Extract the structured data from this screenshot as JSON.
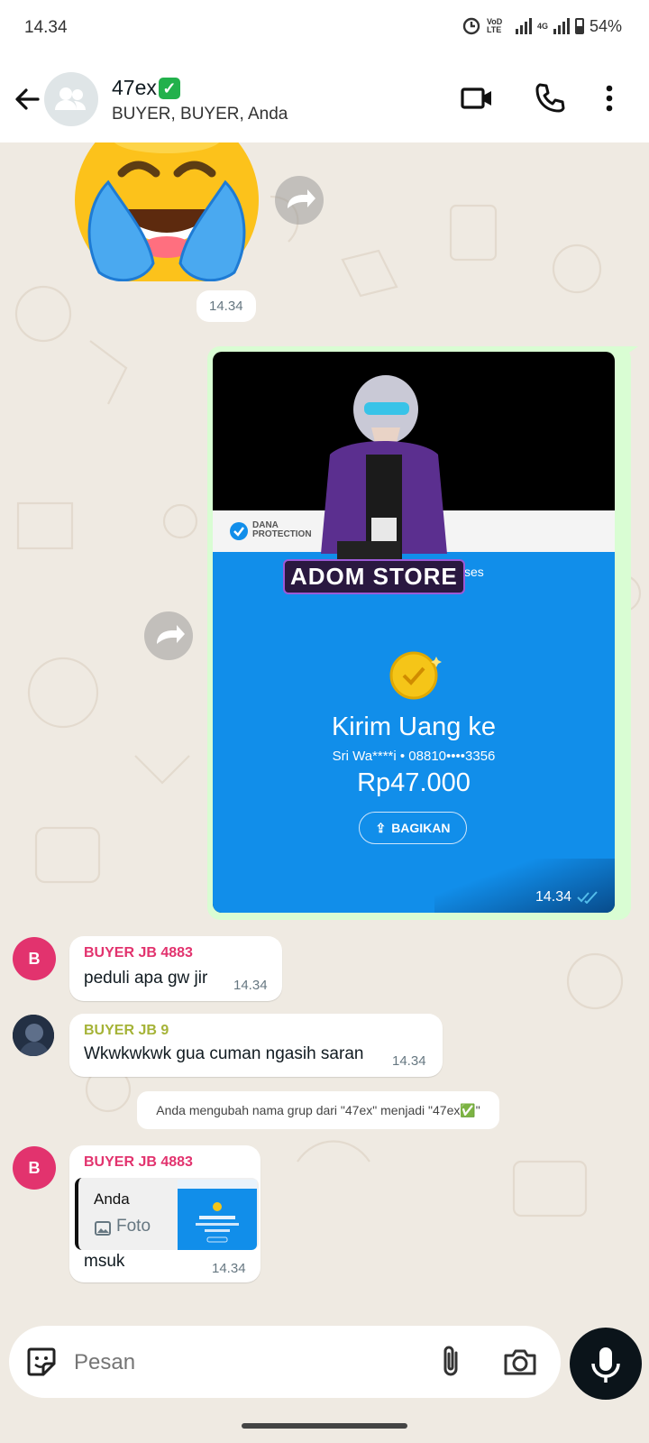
{
  "status_bar": {
    "time": "14.34",
    "network_volte_label": "VoD LTE",
    "network_4g_label": "4G",
    "battery": "54%"
  },
  "header": {
    "group_name": "47ex",
    "members": "BUYER, BUYER, Anda",
    "icons": [
      "back-arrow-icon",
      "group-avatar-icon",
      "video-call-icon",
      "voice-call-icon",
      "more-vert-icon"
    ]
  },
  "messages": [
    {
      "type": "sticker",
      "emoji": "😭",
      "time": "14.34"
    },
    {
      "type": "image_outgoing",
      "time": "14.34",
      "image": {
        "brand": "DANA PROTECTION",
        "watermark": "ADOM STORE",
        "status_partial": "kses",
        "title": "Kirim Uang ke",
        "recipient": "Sri Wa****i • 08810••••3356",
        "amount": "Rp47.000",
        "share_label": "BAGIKAN"
      }
    },
    {
      "type": "incoming",
      "avatar_letter": "B",
      "sender": "BUYER JB 4883",
      "sender_color": "#e2336e",
      "text": "peduli apa gw jir",
      "time": "14.34"
    },
    {
      "type": "incoming",
      "sender": "BUYER JB 9",
      "sender_color": "#a5b337",
      "text": "Wkwkwkwk gua cuman ngasih saran",
      "time": "14.34"
    },
    {
      "type": "system",
      "text": "Anda mengubah nama grup dari \"47ex\" menjadi \"47ex✅\""
    },
    {
      "type": "incoming_reply",
      "avatar_letter": "B",
      "sender": "BUYER JB 4883",
      "sender_color": "#e2336e",
      "quote_author": "Anda",
      "quote_type": "Foto",
      "text": "msuk",
      "time": "14.34"
    }
  ],
  "input": {
    "placeholder": "Pesan"
  },
  "colors": {
    "chat_bg": "#efeae2",
    "outgoing_border": "#d9fdd3",
    "dana_blue": "#118eea",
    "check_blue": "#53bdeb"
  }
}
